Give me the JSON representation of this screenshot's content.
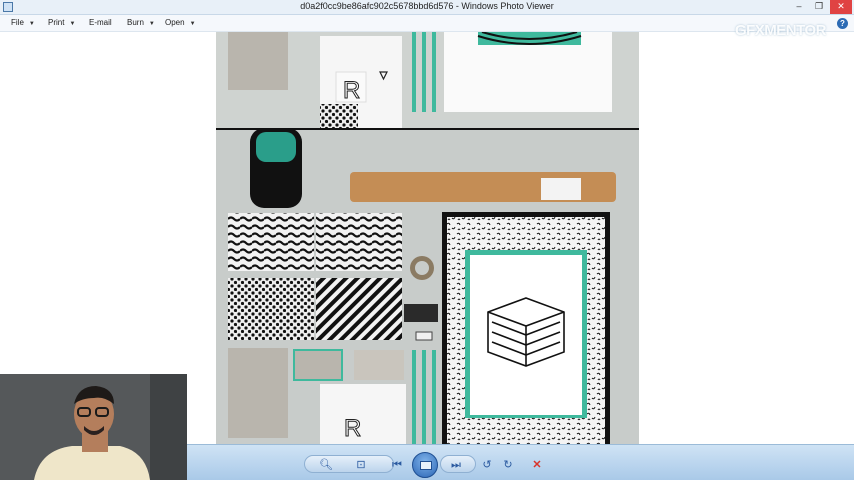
{
  "window": {
    "title": "d0a2f0cc9be86afc902c5678bbd6d576 - Windows Photo Viewer",
    "minimize": "–",
    "restore": "❐",
    "close": "✕"
  },
  "menu": {
    "items": [
      {
        "label": "File",
        "has_arrow": true
      },
      {
        "label": "Print",
        "has_arrow": true
      },
      {
        "label": "E-mail",
        "has_arrow": false
      },
      {
        "label": "Burn",
        "has_arrow": true
      },
      {
        "label": "Open",
        "has_arrow": true
      }
    ],
    "help": "?"
  },
  "watermark": "GFXMENTOR",
  "photo": {
    "subject": "brand stationery mockup with black and white patterns and teal accents",
    "letter_mark": "R"
  },
  "toolbar": {
    "zoom_icon": "magnifier-icon",
    "actual_size_icon": "actual-size-icon",
    "previous_icon": "previous-icon",
    "slideshow_icon": "slideshow-icon",
    "next_icon": "next-icon",
    "rotate_ccw_icon": "rotate-counterclockwise-icon",
    "rotate_cw_icon": "rotate-clockwise-icon",
    "delete_icon": "delete-icon"
  },
  "colors": {
    "accent_teal": "#3fb99d",
    "titlebar": "#e8f0f8",
    "toolbar": "#b7d3ee",
    "delete": "#d9342b"
  }
}
